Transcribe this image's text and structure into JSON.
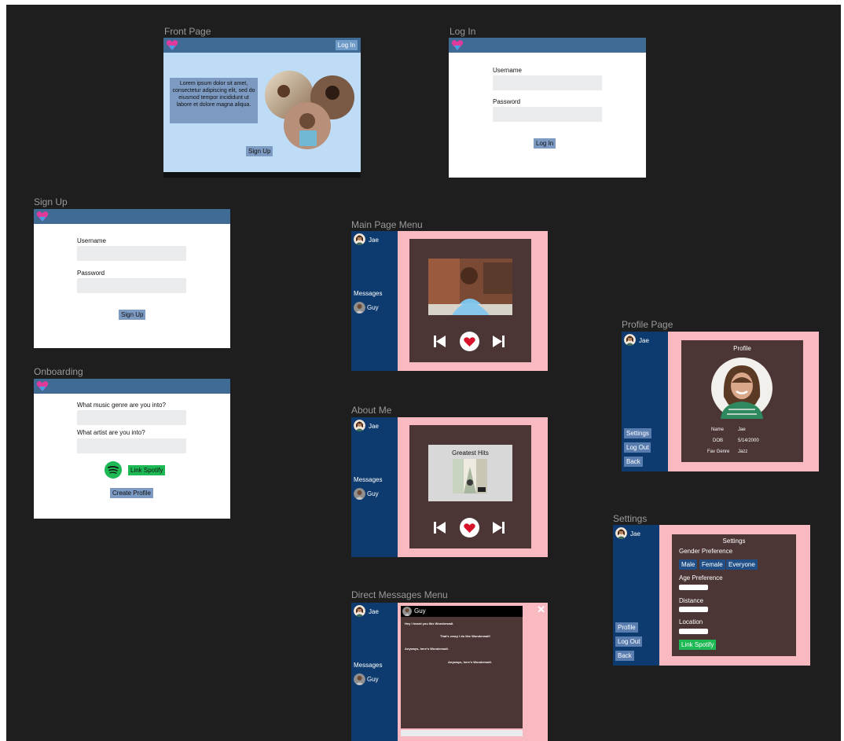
{
  "frames": {
    "front": {
      "title": "Front Page",
      "login_btn": "Log In",
      "lorem": "Lorem ipsum dolor sit amet, consectetur adipiscing elit, sed do eiusmod tempor incididunt ut labore et dolore magna aliqua.",
      "signup_btn": "Sign Up"
    },
    "login": {
      "title": "Log In",
      "username_label": "Username",
      "password_label": "Password",
      "login_btn": "Log In"
    },
    "signup": {
      "title": "Sign Up",
      "username_label": "Username",
      "password_label": "Password",
      "signup_btn": "Sign Up"
    },
    "onboarding": {
      "title": "Onboarding",
      "genre_label": "What music genre are you into?",
      "artist_label": "What artist are you into?",
      "spotify_btn": "Link Spotify",
      "create_btn": "Create Profile"
    },
    "main": {
      "title": "Main Page Menu",
      "user": "Jae",
      "messages": "Messages",
      "contact": "Guy"
    },
    "about": {
      "title": "About Me",
      "user": "Jae",
      "messages": "Messages",
      "contact": "Guy",
      "album_title": "Greatest Hits"
    },
    "dm": {
      "title": "Direct Messages Menu",
      "user": "Jae",
      "messages": "Messages",
      "contact": "Guy",
      "chat_name": "Guy",
      "close": "✕",
      "messages_list": [
        "Hey I heard you like Wonderwall.",
        "That's crazy I do like Wonderwall!",
        "Anyways, here's Wonderwall.",
        "Anyways, here's Wonderwall."
      ]
    },
    "profile": {
      "title": "Profile Page",
      "user": "Jae",
      "heading": "Profile",
      "name_key": "Name",
      "name_val": "Jae",
      "dob_key": "DOB",
      "dob_val": "5/14/2000",
      "genre_key": "Fav Genre",
      "genre_val": "Jazz",
      "settings_btn": "Settings",
      "logout_btn": "Log Out",
      "back_btn": "Back"
    },
    "settings": {
      "title": "Settings",
      "user": "Jae",
      "heading": "Settings",
      "gender_pref": "Gender Preference",
      "opt_male": "Male",
      "opt_female": "Female",
      "opt_everyone": "Everyone",
      "age_pref": "Age Preference",
      "distance": "Distance",
      "location": "Location",
      "spotify_btn": "Link Spotify",
      "profile_btn": "Profile",
      "logout_btn": "Log Out",
      "back_btn": "Back"
    }
  },
  "colors": {
    "canvas": "#1e1e1e",
    "topbar": "#3f6b95",
    "sidebar": "#0d3b6f",
    "pink": "#f8b9c0",
    "dark_panel": "#4b3535",
    "spotify_green": "#1db954",
    "button_blue": "#7c9ac2"
  }
}
